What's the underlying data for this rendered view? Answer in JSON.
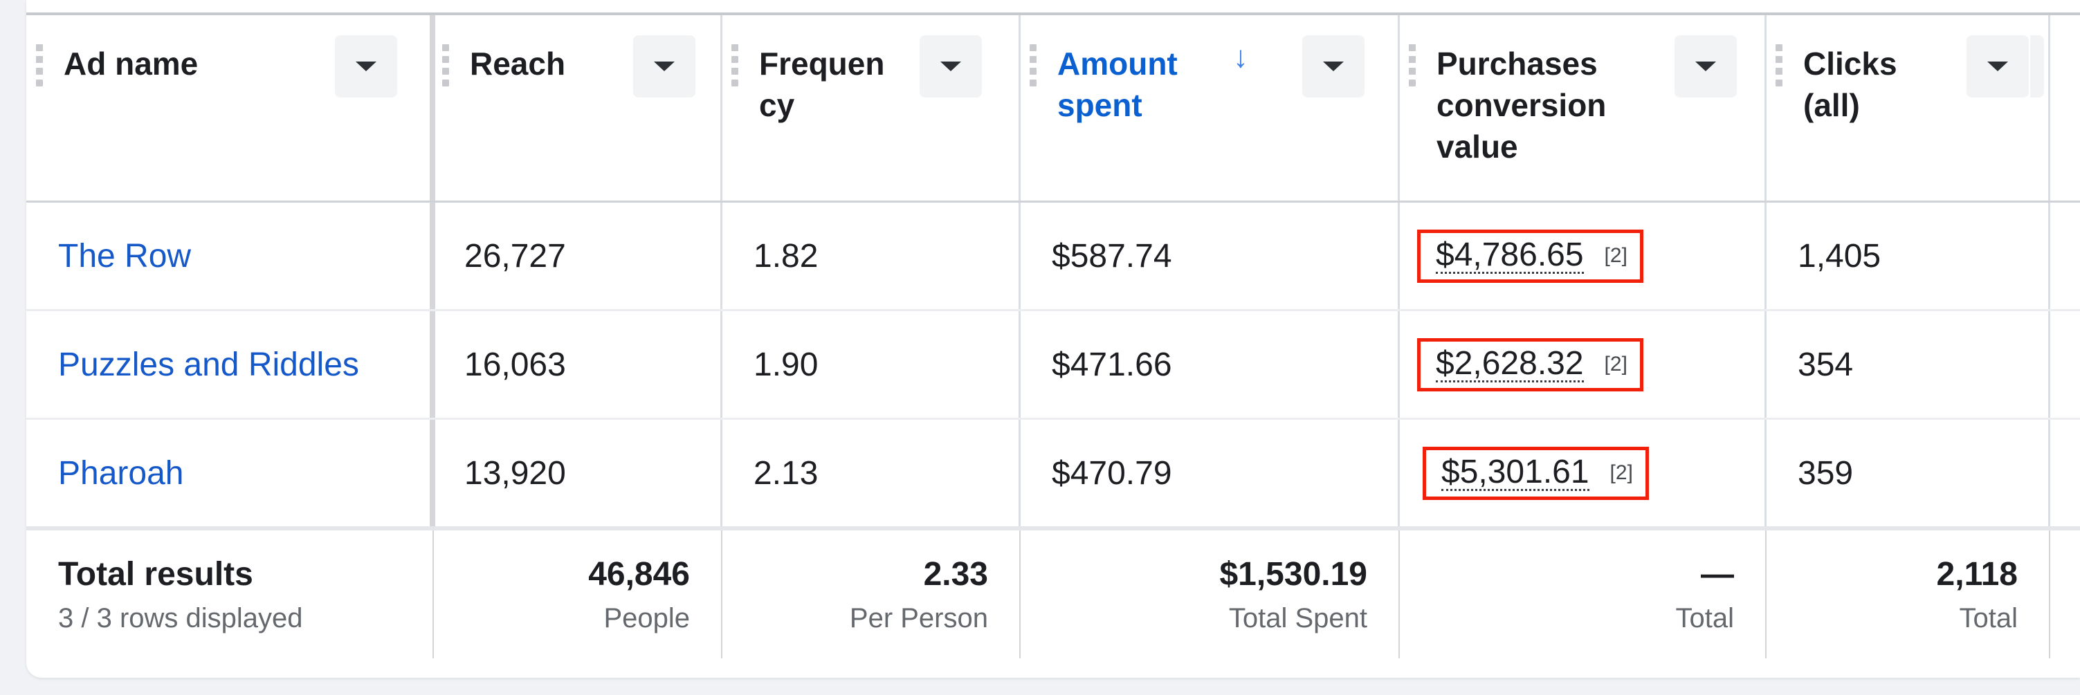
{
  "columns": [
    {
      "key": "ad_name",
      "label": "Ad name",
      "sorted": false
    },
    {
      "key": "reach",
      "label": "Reach",
      "sorted": false
    },
    {
      "key": "frequency",
      "label": "Frequen\ncy",
      "sorted": false
    },
    {
      "key": "amount_spent",
      "label": "Amount\nspent",
      "sorted": true,
      "sort_direction": "descending",
      "sort_icon": "arrow-down-icon"
    },
    {
      "key": "purchases_conversion_value",
      "label": "Purchases\nconversion\nvalue",
      "sorted": false
    },
    {
      "key": "clicks_all",
      "label": "Clicks\n(all)",
      "sorted": false
    }
  ],
  "rows": [
    {
      "ad_name": "The Row",
      "reach": "26,727",
      "frequency": "1.82",
      "amount_spent": "$587.74",
      "purchases_conversion_value": "$4,786.65",
      "pcv_attribution": "[2]",
      "clicks_all": "1,405"
    },
    {
      "ad_name": "Puzzles and Riddles",
      "reach": "16,063",
      "frequency": "1.90",
      "amount_spent": "$471.66",
      "purchases_conversion_value": "$2,628.32",
      "pcv_attribution": "[2]",
      "clicks_all": "354"
    },
    {
      "ad_name": "Pharoah",
      "reach": "13,920",
      "frequency": "2.13",
      "amount_spent": "$470.79",
      "purchases_conversion_value": "$5,301.61",
      "pcv_attribution": "[2]",
      "clicks_all": "359"
    }
  ],
  "totals": {
    "label": "Total results",
    "rows_displayed": "3 / 3 rows displayed",
    "reach": {
      "value": "46,846",
      "unit": "People"
    },
    "frequency": {
      "value": "2.33",
      "unit": "Per Person"
    },
    "amount_spent": {
      "value": "$1,530.19",
      "unit": "Total Spent"
    },
    "purchases_conversion_value": {
      "value": "—",
      "unit": "Total"
    },
    "clicks_all": {
      "value": "2,118",
      "unit": "Total"
    }
  },
  "colors": {
    "link": "#1458c9",
    "sorted_header": "#0a5fd1",
    "highlight_box": "#f0200a"
  }
}
